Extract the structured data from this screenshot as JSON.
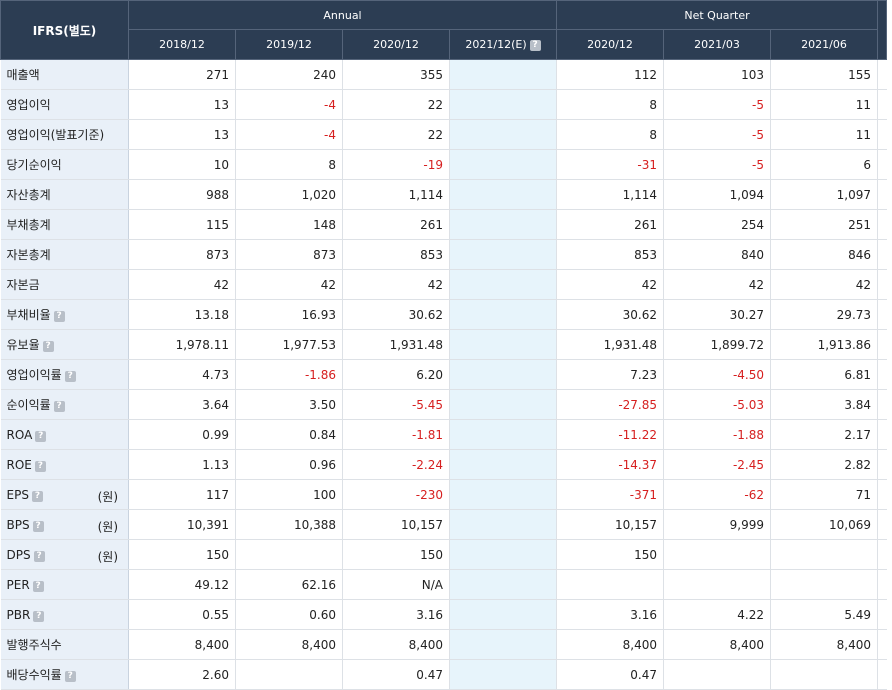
{
  "header": {
    "corner": "IFRS(별도)",
    "annual_label": "Annual",
    "quarter_label": "Net Quarter",
    "columns": [
      "2018/12",
      "2019/12",
      "2020/12",
      "2021/12(E)",
      "2020/12",
      "2021/03",
      "2021/06"
    ],
    "help_icon_text": "?"
  },
  "rows": [
    {
      "label": "매출액",
      "help": false,
      "unit": "",
      "values": [
        "271",
        "240",
        "355",
        "",
        "112",
        "103",
        "155"
      ]
    },
    {
      "label": "영업이익",
      "help": false,
      "unit": "",
      "values": [
        "13",
        "-4",
        "22",
        "",
        "8",
        "-5",
        "11"
      ]
    },
    {
      "label": "영업이익(발표기준)",
      "help": false,
      "unit": "",
      "values": [
        "13",
        "-4",
        "22",
        "",
        "8",
        "-5",
        "11"
      ]
    },
    {
      "label": "당기순이익",
      "help": false,
      "unit": "",
      "values": [
        "10",
        "8",
        "-19",
        "",
        "-31",
        "-5",
        "6"
      ]
    },
    {
      "label": "자산총계",
      "help": false,
      "unit": "",
      "values": [
        "988",
        "1,020",
        "1,114",
        "",
        "1,114",
        "1,094",
        "1,097"
      ]
    },
    {
      "label": "부채총계",
      "help": false,
      "unit": "",
      "values": [
        "115",
        "148",
        "261",
        "",
        "261",
        "254",
        "251"
      ]
    },
    {
      "label": "자본총계",
      "help": false,
      "unit": "",
      "values": [
        "873",
        "873",
        "853",
        "",
        "853",
        "840",
        "846"
      ]
    },
    {
      "label": "자본금",
      "help": false,
      "unit": "",
      "values": [
        "42",
        "42",
        "42",
        "",
        "42",
        "42",
        "42"
      ]
    },
    {
      "label": "부채비율",
      "help": true,
      "unit": "",
      "values": [
        "13.18",
        "16.93",
        "30.62",
        "",
        "30.62",
        "30.27",
        "29.73"
      ]
    },
    {
      "label": "유보율",
      "help": true,
      "unit": "",
      "values": [
        "1,978.11",
        "1,977.53",
        "1,931.48",
        "",
        "1,931.48",
        "1,899.72",
        "1,913.86"
      ]
    },
    {
      "label": "영업이익률",
      "help": true,
      "unit": "",
      "values": [
        "4.73",
        "-1.86",
        "6.20",
        "",
        "7.23",
        "-4.50",
        "6.81"
      ]
    },
    {
      "label": "순이익률",
      "help": true,
      "unit": "",
      "values": [
        "3.64",
        "3.50",
        "-5.45",
        "",
        "-27.85",
        "-5.03",
        "3.84"
      ]
    },
    {
      "label": "ROA",
      "help": true,
      "unit": "",
      "values": [
        "0.99",
        "0.84",
        "-1.81",
        "",
        "-11.22",
        "-1.88",
        "2.17"
      ]
    },
    {
      "label": "ROE",
      "help": true,
      "unit": "",
      "values": [
        "1.13",
        "0.96",
        "-2.24",
        "",
        "-14.37",
        "-2.45",
        "2.82"
      ]
    },
    {
      "label": "EPS",
      "help": true,
      "unit": "(원)",
      "values": [
        "117",
        "100",
        "-230",
        "",
        "-371",
        "-62",
        "71"
      ]
    },
    {
      "label": "BPS",
      "help": true,
      "unit": "(원)",
      "values": [
        "10,391",
        "10,388",
        "10,157",
        "",
        "10,157",
        "9,999",
        "10,069"
      ]
    },
    {
      "label": "DPS",
      "help": true,
      "unit": "(원)",
      "values": [
        "150",
        "",
        "150",
        "",
        "150",
        "",
        ""
      ]
    },
    {
      "label": "PER",
      "help": true,
      "unit": "",
      "values": [
        "49.12",
        "62.16",
        "N/A",
        "",
        "",
        "",
        ""
      ]
    },
    {
      "label": "PBR",
      "help": true,
      "unit": "",
      "values": [
        "0.55",
        "0.60",
        "3.16",
        "",
        "3.16",
        "4.22",
        "5.49"
      ]
    },
    {
      "label": "발행주식수",
      "help": false,
      "unit": "",
      "values": [
        "8,400",
        "8,400",
        "8,400",
        "",
        "8,400",
        "8,400",
        "8,400"
      ]
    },
    {
      "label": "배당수익률",
      "help": true,
      "unit": "",
      "values": [
        "2.60",
        "",
        "0.47",
        "",
        "0.47",
        "",
        ""
      ]
    }
  ],
  "colors": {
    "header_bg": "#2c3d53",
    "label_bg": "#e9f0f8",
    "estimate_bg": "#e7f4fb",
    "negative": "#d61f1f"
  }
}
